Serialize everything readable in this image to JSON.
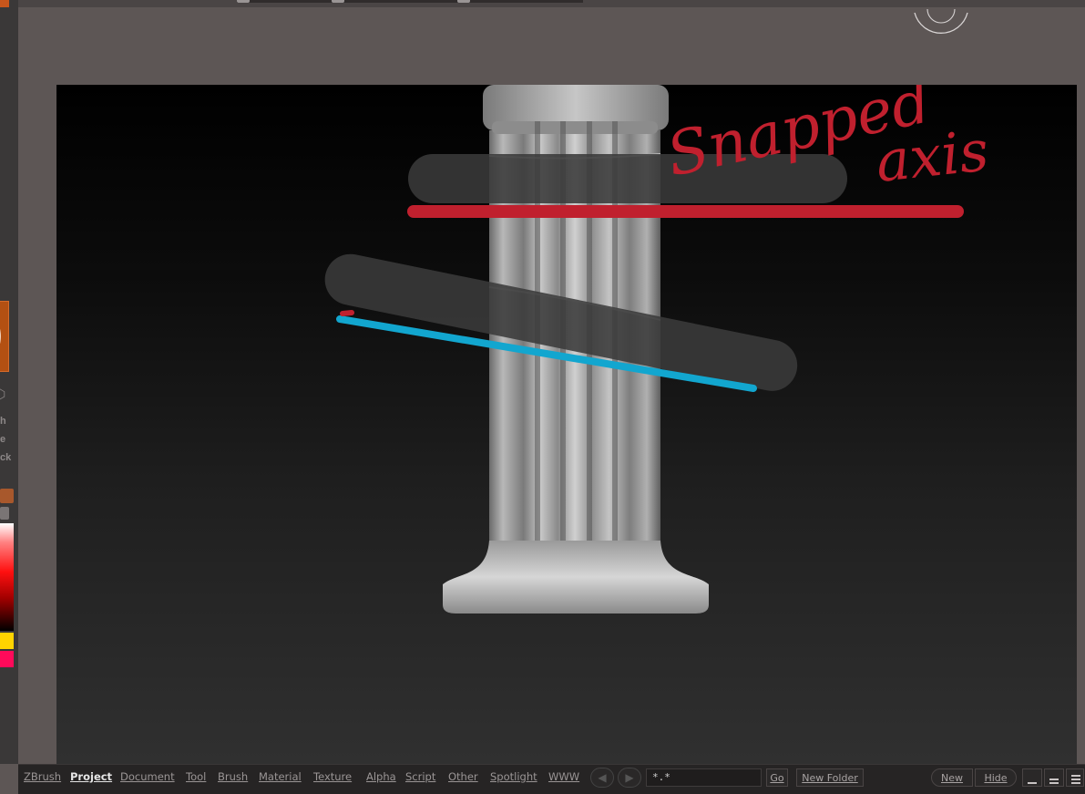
{
  "app": {
    "name": "ZBrush"
  },
  "annotations": {
    "snapped_label_line1": "Snapped",
    "snapped_label_line2": "axis"
  },
  "colors": {
    "annotation_red": "#c0202e",
    "annotation_blue": "#12a6cf",
    "brush_primary": "#ffd400",
    "brush_secondary": "#ff0a5a"
  },
  "left_tray_fragments": [
    "h",
    "e",
    "ck"
  ],
  "bottom_bar": {
    "menus": [
      {
        "label": "ZBrush",
        "active": false
      },
      {
        "label": "Project",
        "active": true
      },
      {
        "label": "Document",
        "active": false
      },
      {
        "label": "Tool",
        "active": false
      },
      {
        "label": "Brush",
        "active": false
      },
      {
        "label": "Material",
        "active": false
      },
      {
        "label": "Texture",
        "active": false
      },
      {
        "label": "Alpha",
        "active": false
      },
      {
        "label": "Script",
        "active": false
      },
      {
        "label": "Other",
        "active": false
      },
      {
        "label": "Spotlight",
        "active": false
      },
      {
        "label": "WWW",
        "active": false
      }
    ],
    "filter_value": "*.*",
    "go_label": "Go",
    "new_folder_label": "New Folder",
    "new_label": "New",
    "hide_label": "Hide"
  }
}
